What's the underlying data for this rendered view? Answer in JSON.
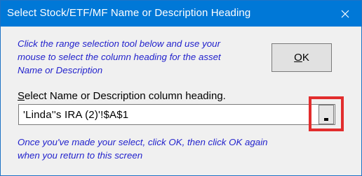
{
  "window": {
    "title": "Select Stock/ETF/MF Name or Description Heading",
    "close_icon": "close-icon"
  },
  "instruction": {
    "line1": "Click the range selection tool below and use your",
    "line2": "mouse to select the column heading for the asset",
    "line3": "Name or Description"
  },
  "ok_button": {
    "mnemonic": "O",
    "rest": "K"
  },
  "field": {
    "label_mnemonic": "S",
    "label_rest": "elect Name or Description column heading.",
    "value": "'Linda''s IRA (2)'!$A$1"
  },
  "highlight_color": "#e22d2d",
  "footnote": {
    "line1": "Once you've made your select, click OK, then click OK again",
    "line2": "when you return to this screen"
  }
}
